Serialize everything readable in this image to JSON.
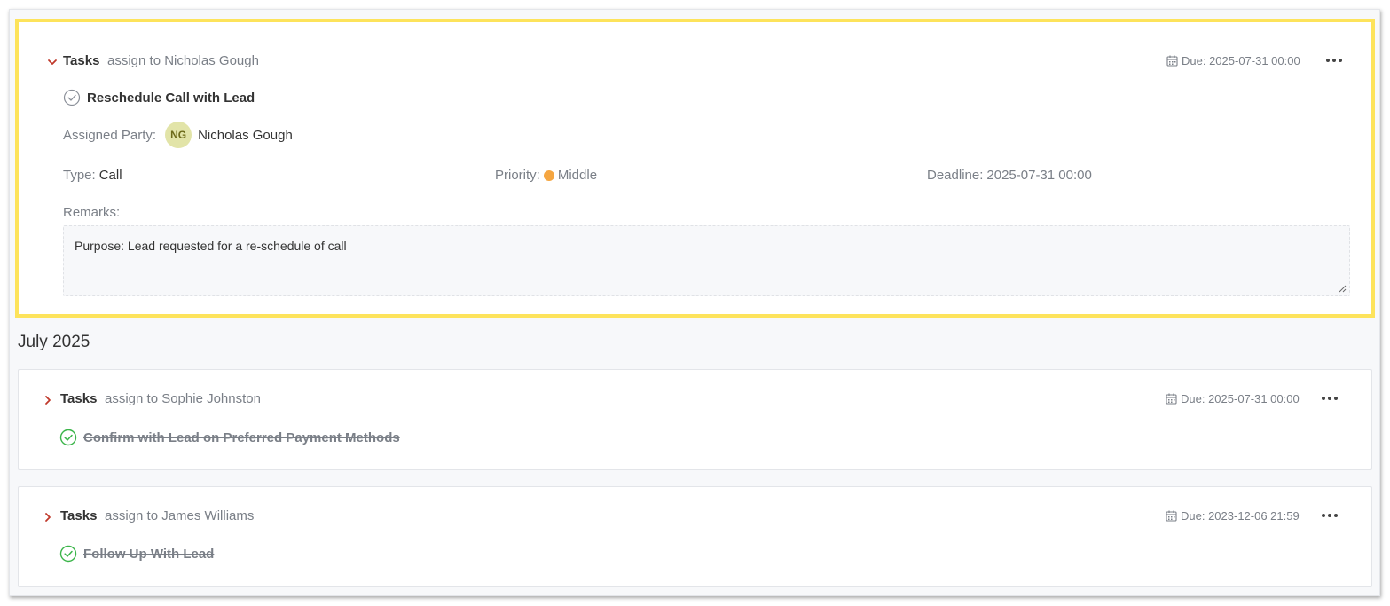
{
  "highlighted_task": {
    "type_label": "Tasks",
    "assign_text": "assign to Nicholas Gough",
    "due_text": "Due: 2025-07-31 00:00",
    "title": "Reschedule Call with Lead",
    "assigned_party_label": "Assigned Party:",
    "assignee_initials": "NG",
    "assignee_name": "Nicholas Gough",
    "type_field_label": "Type:",
    "type_value": "Call",
    "priority_label": "Priority:",
    "priority_value": "Middle",
    "priority_color": "#f5a641",
    "deadline_label": "Deadline:",
    "deadline_value": "2025-07-31 00:00",
    "remarks_label": "Remarks:",
    "remarks_value": "Purpose: Lead requested for a re-schedule of call"
  },
  "section": {
    "title": "July 2025"
  },
  "tasks": [
    {
      "type_label": "Tasks",
      "assign_text": "assign to Sophie Johnston",
      "due_text": "Due: 2025-07-31 00:00",
      "title": "Confirm with Lead on Preferred Payment Methods",
      "completed": true
    },
    {
      "type_label": "Tasks",
      "assign_text": "assign to James Williams",
      "due_text": "Due: 2023-12-06 21:59",
      "title": "Follow Up With Lead",
      "completed": true
    }
  ],
  "colors": {
    "highlight_border": "#fde35b",
    "chevron": "#c0392b",
    "done_check": "#3bb54a",
    "pending_check": "#8a8f98"
  },
  "icons": {
    "chevron_expanded": "chevron-down-icon",
    "chevron_collapsed": "chevron-right-icon",
    "calendar": "calendar-icon",
    "more": "more-icon",
    "check_pending": "check-circle-outline-icon",
    "check_done": "check-circle-done-icon"
  }
}
